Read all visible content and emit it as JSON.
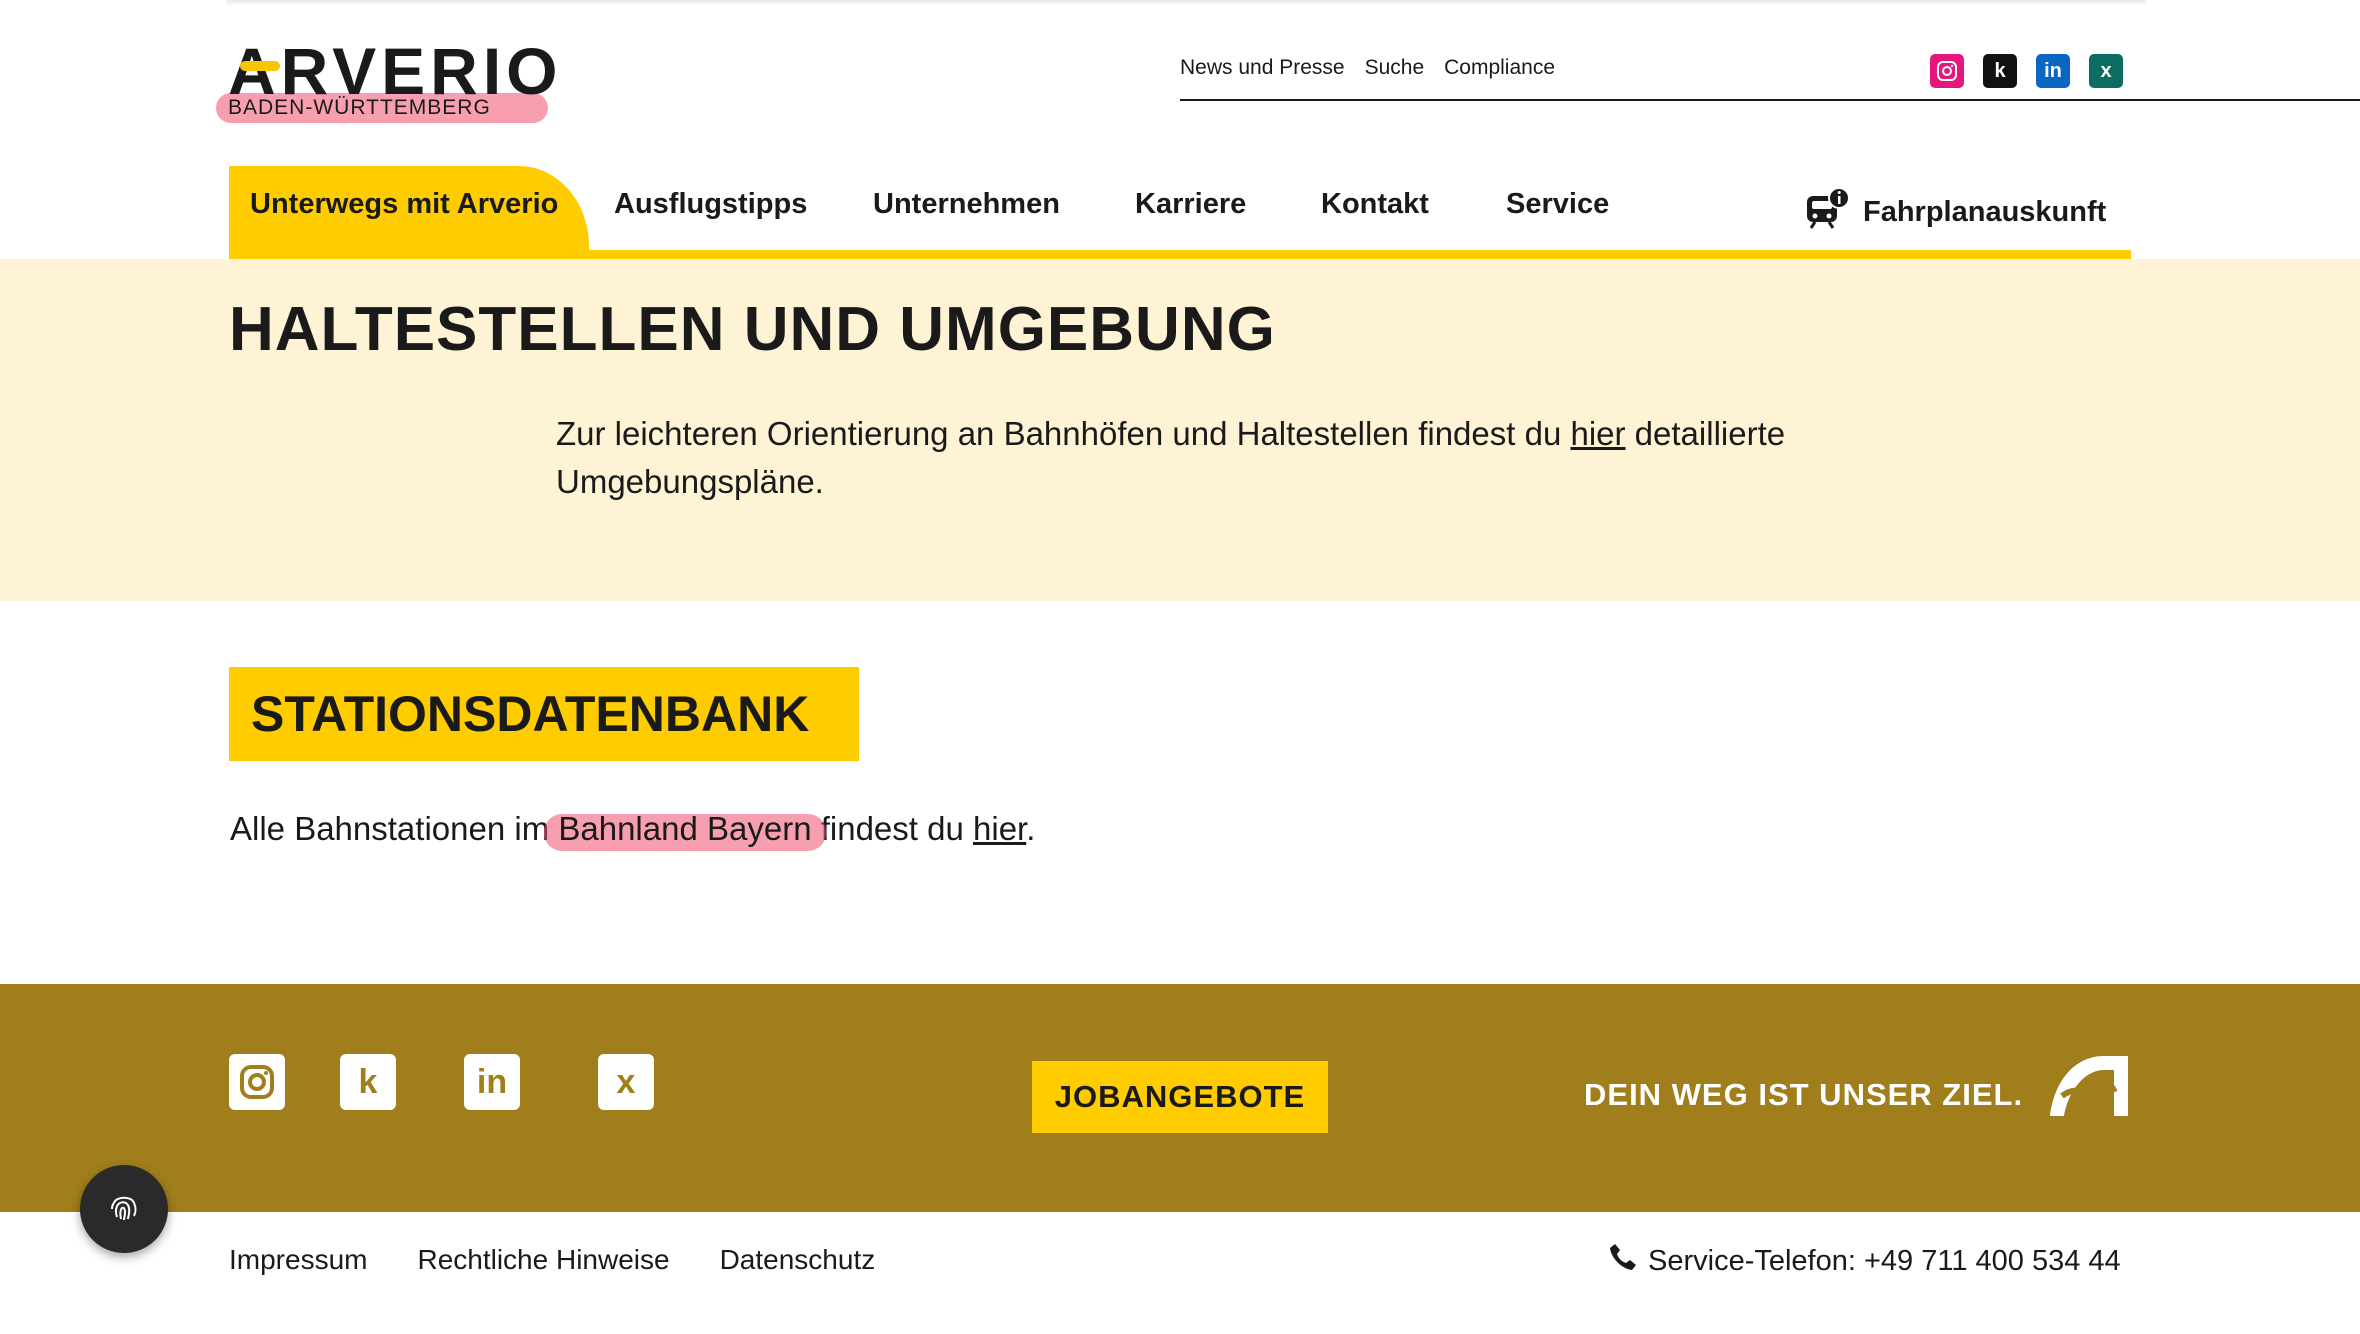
{
  "header": {
    "logo_word": "ARVERIO",
    "logo_sub": "BADEN-WÜRTTEMBERG",
    "meta_links": [
      "News und Presse",
      "Suche",
      "Compliance"
    ],
    "social": [
      {
        "icon": "instagram-icon",
        "color": "#e4187c"
      },
      {
        "icon": "kununu-icon",
        "color": "#111111"
      },
      {
        "icon": "linkedin-icon",
        "color": "#0a66c2"
      },
      {
        "icon": "xing-icon",
        "color": "#0b6d62"
      }
    ]
  },
  "nav": {
    "items": [
      "Unterwegs mit Arverio",
      "Ausflugstipps",
      "Unternehmen",
      "Karriere",
      "Kontakt",
      "Service"
    ],
    "active": "Unterwegs mit Arverio",
    "timetable": "Fahrplanauskunft"
  },
  "hero": {
    "title": "HALTESTELLEN UND UMGEBUNG",
    "text_before": "Zur leichteren Orientierung an Bahnhöfen und Haltestellen findest du ",
    "link": "hier",
    "text_after": " detaillierte Umgebungspläne."
  },
  "stations": {
    "heading": "STATIONSDATENBANK",
    "text_before": "Alle Bahnstationen im ",
    "highlight": "Bahnland Bayern",
    "text_middle": " findest du ",
    "link": "hier",
    "text_after": "."
  },
  "footer": {
    "job_button": "JOBANGEBOTE",
    "slogan": "DEIN WEG IST UNSER ZIEL.",
    "links": [
      "Impressum",
      "Rechtliche Hinweise",
      "Datenschutz"
    ],
    "phone": "Service-Telefon: +49 711 400 534 44"
  },
  "colors": {
    "accent": "#ffcc00",
    "band": "#fff3d6",
    "footer": "#a07e1c",
    "highlight": "#f0506e"
  }
}
